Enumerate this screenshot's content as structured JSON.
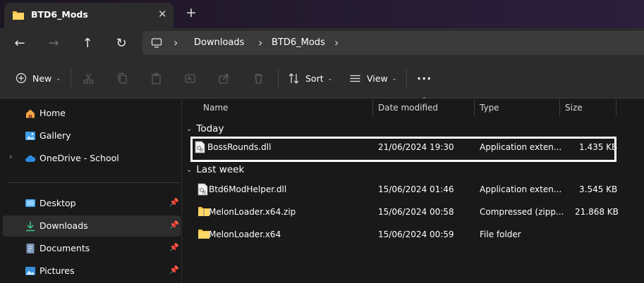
{
  "window": {
    "tab_title": "BTD6_Mods",
    "tab_close": "✕",
    "new_tab": "+"
  },
  "navigation": {
    "back": "←",
    "forward": "→",
    "up": "↑",
    "refresh": "↻"
  },
  "breadcrumb": {
    "separator": "›",
    "items": [
      "Downloads",
      "BTD6_Mods"
    ]
  },
  "commandbar": {
    "new_label": "New",
    "sort_label": "Sort",
    "view_label": "View",
    "more": "···",
    "caret": "⌄"
  },
  "sidebar": {
    "quick": [
      {
        "label": "Home"
      },
      {
        "label": "Gallery"
      },
      {
        "label": "OneDrive - School"
      }
    ],
    "pinned": [
      {
        "label": "Desktop"
      },
      {
        "label": "Downloads"
      },
      {
        "label": "Documents"
      },
      {
        "label": "Pictures"
      }
    ],
    "selected": "Downloads"
  },
  "columns": {
    "name": "Name",
    "date": "Date modified",
    "type": "Type",
    "size": "Size"
  },
  "groups": [
    {
      "label": "Today",
      "files": [
        {
          "name": "BossRounds.dll",
          "date": "21/06/2024 19:30",
          "type": "Application exten...",
          "size": "1.435 KB",
          "kind": "dll"
        }
      ]
    },
    {
      "label": "Last week",
      "files": [
        {
          "name": "Btd6ModHelper.dll",
          "date": "15/06/2024 01:46",
          "type": "Application exten...",
          "size": "3.545 KB",
          "kind": "dll"
        },
        {
          "name": "MelonLoader.x64.zip",
          "date": "15/06/2024 00:58",
          "type": "Compressed (zipp...",
          "size": "21.868 KB",
          "kind": "zip"
        },
        {
          "name": "MelonLoader.x64",
          "date": "15/06/2024 00:59",
          "type": "File folder",
          "size": "",
          "kind": "folder"
        }
      ]
    }
  ],
  "colors": {
    "folder": "#f6c244",
    "accent": "#4cc2ff",
    "highlight_border": "#ffffff"
  }
}
